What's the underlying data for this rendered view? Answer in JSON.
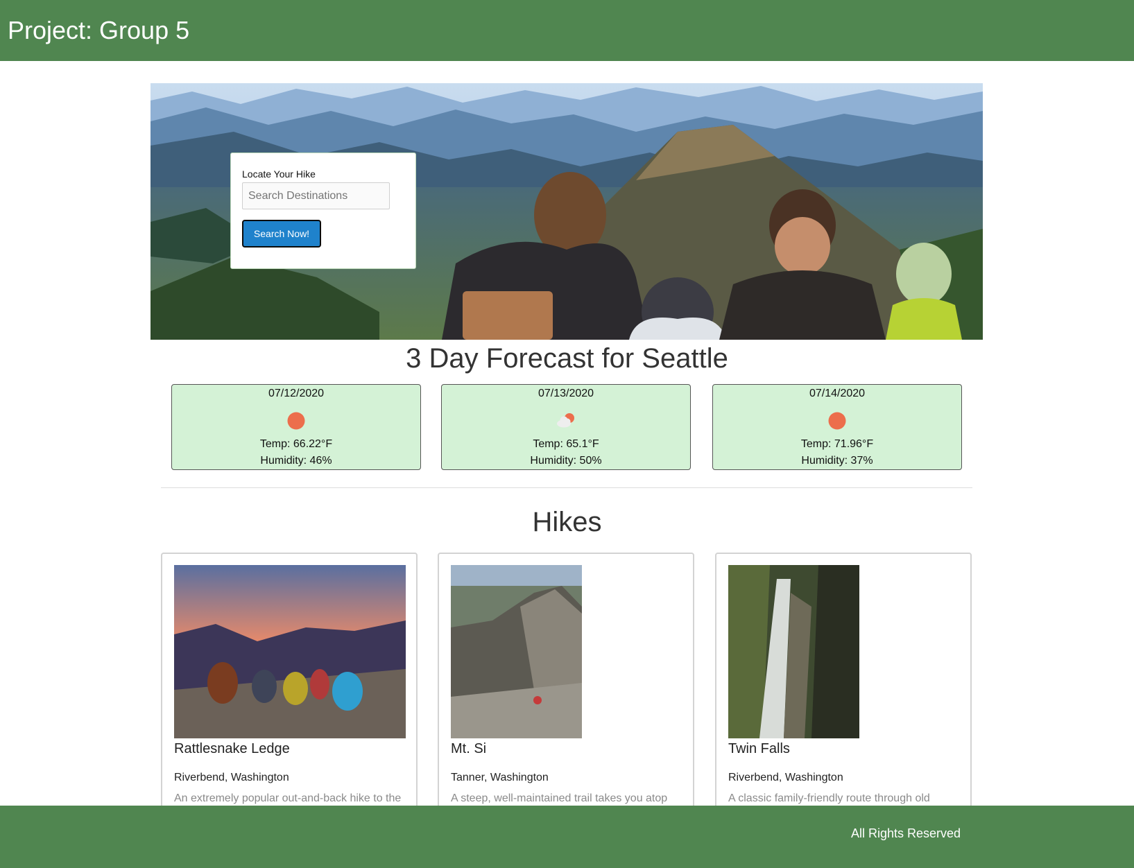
{
  "header": {
    "title": "Project: Group 5"
  },
  "search": {
    "label": "Locate Your Hike",
    "placeholder": "Search Destinations",
    "button": "Search Now!"
  },
  "forecast": {
    "title": "3 Day Forecast for Seattle",
    "days": [
      {
        "date": "07/12/2020",
        "icon": "sun-icon",
        "temp": "Temp: 66.22°F",
        "humidity": "Humidity: 46%"
      },
      {
        "date": "07/13/2020",
        "icon": "partly-cloudy-icon",
        "temp": "Temp: 65.1°F",
        "humidity": "Humidity: 50%"
      },
      {
        "date": "07/14/2020",
        "icon": "sun-icon",
        "temp": "Temp: 71.96°F",
        "humidity": "Humidity: 37%"
      }
    ]
  },
  "hikes": {
    "title": "Hikes",
    "items": [
      {
        "name": "Rattlesnake Ledge",
        "location": "Riverbend, Washington",
        "description": "An extremely popular out-and-back hike to the"
      },
      {
        "name": "Mt. Si",
        "location": "Tanner, Washington",
        "description": "A steep, well-maintained trail takes you atop"
      },
      {
        "name": "Twin Falls",
        "location": "Riverbend, Washington",
        "description": "A classic family-friendly route through old"
      }
    ]
  },
  "footer": {
    "text": "All Rights Reserved"
  },
  "colors": {
    "brand": "#508650",
    "forecast_card": "#d4f2d6",
    "button": "#1f82cc",
    "sun": "#ec6e4c"
  }
}
